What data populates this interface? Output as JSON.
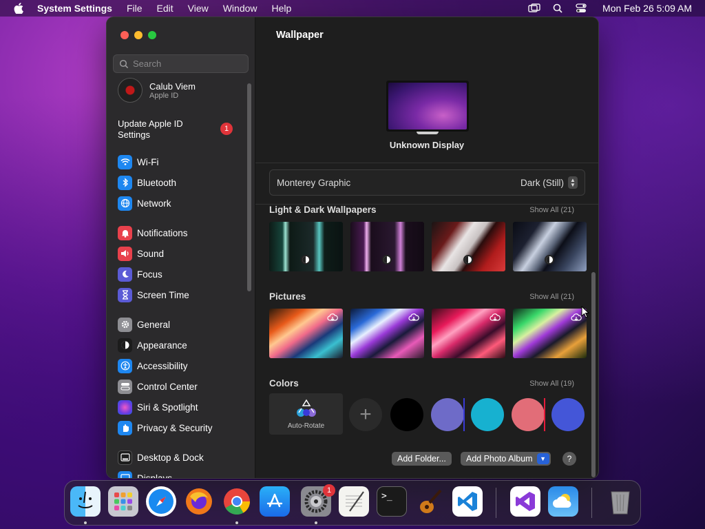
{
  "menubar": {
    "app_name": "System Settings",
    "menus": [
      "File",
      "Edit",
      "View",
      "Window",
      "Help"
    ],
    "clock": "Mon Feb 26  5:09 AM"
  },
  "sidebar": {
    "search_placeholder": "Search",
    "profile": {
      "name": "Calub Viem",
      "subtitle": "Apple ID"
    },
    "update": {
      "label": "Update Apple ID Settings",
      "badge": "1"
    },
    "items": [
      {
        "label": "Wi-Fi",
        "icon": "wifi-icon",
        "color": "#1e87f0"
      },
      {
        "label": "Bluetooth",
        "icon": "bluetooth-icon",
        "color": "#1e87f0"
      },
      {
        "label": "Network",
        "icon": "globe-icon",
        "color": "#1e87f0"
      },
      {
        "label": "Notifications",
        "icon": "bell-icon",
        "color": "#e8414c"
      },
      {
        "label": "Sound",
        "icon": "speaker-icon",
        "color": "#e8414c"
      },
      {
        "label": "Focus",
        "icon": "moon-icon",
        "color": "#5b5bd6"
      },
      {
        "label": "Screen Time",
        "icon": "hourglass-icon",
        "color": "#5b5bd6"
      },
      {
        "label": "General",
        "icon": "gear-icon",
        "color": "#8e8e93"
      },
      {
        "label": "Appearance",
        "icon": "appearance-icon",
        "color": "#1c1c1c"
      },
      {
        "label": "Accessibility",
        "icon": "accessibility-icon",
        "color": "#1e87f0"
      },
      {
        "label": "Control Center",
        "icon": "control-center-icon",
        "color": "#8e8e93"
      },
      {
        "label": "Siri & Spotlight",
        "icon": "siri-icon",
        "color": "#b03ad0"
      },
      {
        "label": "Privacy & Security",
        "icon": "hand-icon",
        "color": "#1e87f0"
      },
      {
        "label": "Desktop & Dock",
        "icon": "dock-icon",
        "color": "#1c1c1c"
      },
      {
        "label": "Displays",
        "icon": "display-icon",
        "color": "#1e87f0"
      }
    ]
  },
  "main": {
    "title": "Wallpaper",
    "display_name": "Unknown Display",
    "selected_wallpaper": "Monterey Graphic",
    "appearance_mode": "Dark (Still)",
    "sections": {
      "light_dark": {
        "title": "Light & Dark Wallpapers",
        "show_all": "Show All (21)"
      },
      "pictures": {
        "title": "Pictures",
        "show_all": "Show All (21)"
      },
      "colors": {
        "title": "Colors",
        "show_all": "Show All (19)"
      }
    },
    "auto_rotate_label": "Auto-Rotate",
    "color_swatches": [
      "#000000",
      "#6e6bc8",
      "#17b1d0",
      "#e26d78",
      "#4456d8"
    ],
    "buttons": {
      "add_folder": "Add Folder...",
      "add_photo_album": "Add Photo Album",
      "help": "?"
    }
  },
  "dock": {
    "apps": [
      "Finder",
      "Launchpad",
      "Safari",
      "Firefox",
      "Chrome",
      "App Store",
      "System Settings",
      "TextEdit",
      "Terminal",
      "GarageBand",
      "Visual Studio Code",
      "Visual Studio",
      "Weather",
      "Trash"
    ],
    "settings_badge": "1"
  }
}
